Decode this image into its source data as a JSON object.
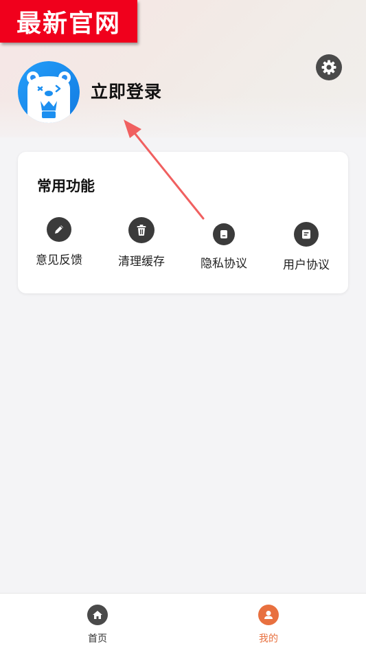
{
  "watermark": {
    "text": "最新官网"
  },
  "profile": {
    "login_text": "立即登录"
  },
  "common": {
    "title": "常用功能",
    "items": [
      {
        "label": "意见反馈",
        "icon": "pencil-icon"
      },
      {
        "label": "清理缓存",
        "icon": "trash-icon"
      },
      {
        "label": "隐私协议",
        "icon": "document-icon"
      },
      {
        "label": "用户协议",
        "icon": "note-icon"
      }
    ]
  },
  "tabbar": {
    "items": [
      {
        "label": "首页",
        "icon": "home-icon",
        "active": false
      },
      {
        "label": "我的",
        "icon": "user-icon",
        "active": true
      }
    ]
  },
  "colors": {
    "accent": "#e8703f",
    "tab_inactive": "#333333",
    "watermark_bg": "#f0001c",
    "avatar_blue": "#1c8ff0",
    "arrow": "#f06060"
  }
}
